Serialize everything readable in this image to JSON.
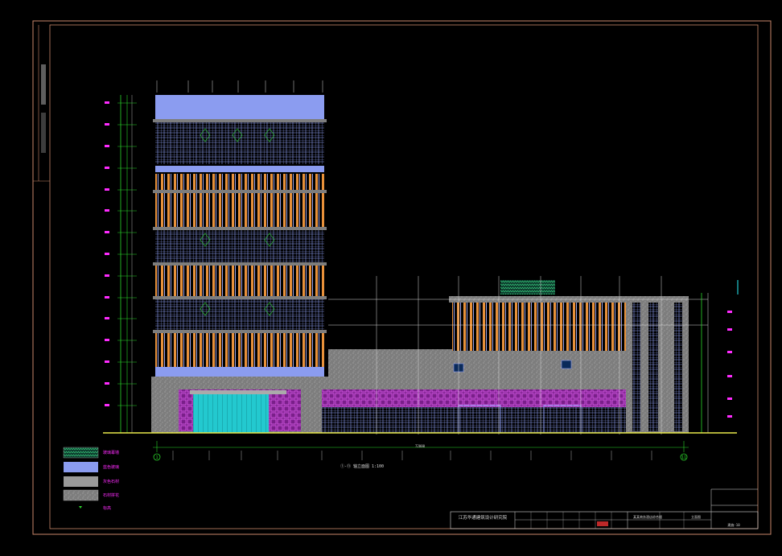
{
  "drawing": {
    "caption": "①-⑪ 轴立面图 1:100",
    "grid_axis_left": "1",
    "grid_axis_right": "11",
    "overall_dimension": "72000"
  },
  "legend": [
    {
      "label": "玻璃幕墙",
      "swatch": "glass-hatch"
    },
    {
      "label": "蓝色玻璃",
      "swatch": "blue"
    },
    {
      "label": "灰色石材",
      "swatch": "gray"
    },
    {
      "label": "石材拼花",
      "swatch": "stone-dot"
    },
    {
      "label": "标高",
      "swatch": "level-mark"
    }
  ],
  "title_block": {
    "company": "江苏华通建筑设计研究院",
    "project": "某某商务酒店综合楼",
    "drawing_title": "立面图",
    "drawing_no": "建施-10"
  },
  "colors": {
    "frame": "#c8866a",
    "grid": "#d8d8d8",
    "orange": "#e8913a",
    "glass_blue": "#8b9cf0",
    "magenta": "#c23bd0",
    "cyan": "#2ee6e6",
    "stone": "#8f8f8f",
    "dim_green": "#2bd62b"
  }
}
